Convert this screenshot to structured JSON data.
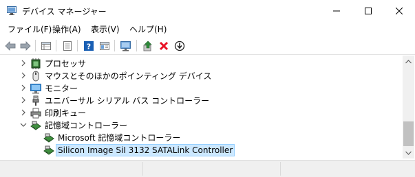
{
  "window": {
    "title": "デバイス マネージャー"
  },
  "menu": [
    {
      "label": "ファイル(F)"
    },
    {
      "label": "操作(A)"
    },
    {
      "label": "表示(V)"
    },
    {
      "label": "ヘルプ(H)"
    }
  ],
  "toolbar": {
    "icons": [
      "back-arrow-icon",
      "forward-arrow-icon",
      "properties-grid-icon",
      "document-list-icon",
      "help-icon",
      "view-pane-icon",
      "monitor-scan-icon",
      "update-driver-icon",
      "uninstall-x-icon",
      "disable-device-icon"
    ],
    "colors": {
      "uninstall": "#e81123",
      "help": "#1a5fb4",
      "update": "#2e8b3a"
    }
  },
  "tree": {
    "items": [
      {
        "label": "プロセッサ",
        "icon": "processor-icon",
        "expanded": false,
        "level": 0
      },
      {
        "label": "マウスとそのほかのポインティング デバイス",
        "icon": "mouse-icon",
        "expanded": false,
        "level": 0
      },
      {
        "label": "モニター",
        "icon": "monitor-icon",
        "expanded": false,
        "level": 0
      },
      {
        "label": "ユニバーサル シリアル バス コントローラー",
        "icon": "usb-icon",
        "expanded": false,
        "level": 0
      },
      {
        "label": "印刷キュー",
        "icon": "printer-icon",
        "expanded": false,
        "level": 0
      },
      {
        "label": "記憶域コントローラー",
        "icon": "storage-controller-icon",
        "expanded": true,
        "level": 0
      },
      {
        "label": "Microsoft 記憶域コントローラー",
        "icon": "storage-controller-icon",
        "level": 1
      },
      {
        "label": "Silicon Image SiI 3132 SATALink Controller",
        "icon": "storage-controller-icon",
        "level": 1,
        "selected": true
      }
    ],
    "selection_color": "#cce8ff"
  }
}
